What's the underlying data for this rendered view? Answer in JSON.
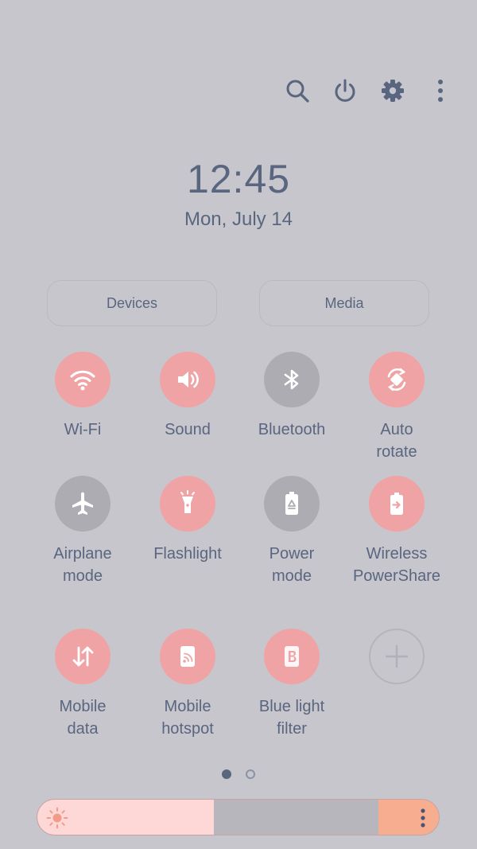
{
  "clock": {
    "time": "12:45",
    "date": "Mon, July 14"
  },
  "top_icons": [
    "search-icon",
    "power-icon",
    "settings-icon",
    "more-icon"
  ],
  "buttons": {
    "devices": "Devices",
    "media": "Media"
  },
  "tiles": [
    {
      "label": "Wi-Fi",
      "state": "on",
      "icon": "wifi-icon"
    },
    {
      "label": "Sound",
      "state": "on",
      "icon": "sound-icon"
    },
    {
      "label": "Bluetooth",
      "state": "off",
      "icon": "bluetooth-icon"
    },
    {
      "label": "Auto\nrotate",
      "state": "on",
      "icon": "auto-rotate-icon"
    },
    {
      "label": "Airplane\nmode",
      "state": "off",
      "icon": "airplane-icon"
    },
    {
      "label": "Flashlight",
      "state": "on",
      "icon": "flashlight-icon"
    },
    {
      "label": "Power\nmode",
      "state": "off",
      "icon": "power-mode-icon"
    },
    {
      "label": "Wireless\nPowerShare",
      "state": "on",
      "icon": "wireless-powershare-icon"
    },
    {
      "label": "Mobile\ndata",
      "state": "on",
      "icon": "mobile-data-icon"
    },
    {
      "label": "Mobile\nhotspot",
      "state": "on",
      "icon": "mobile-hotspot-icon"
    },
    {
      "label": "Blue light\nfilter",
      "state": "on",
      "icon": "blue-light-filter-icon"
    }
  ],
  "add_tile": {
    "icon": "add-icon"
  },
  "pager": {
    "pages": 2,
    "current": 1
  },
  "brightness": {
    "level": 0.44,
    "icon": "brightness-sun-icon"
  },
  "colors": {
    "background": "#c6c6cc",
    "accent": "#f0a3a4",
    "off": "#acacb2",
    "text": "#5a6680"
  }
}
